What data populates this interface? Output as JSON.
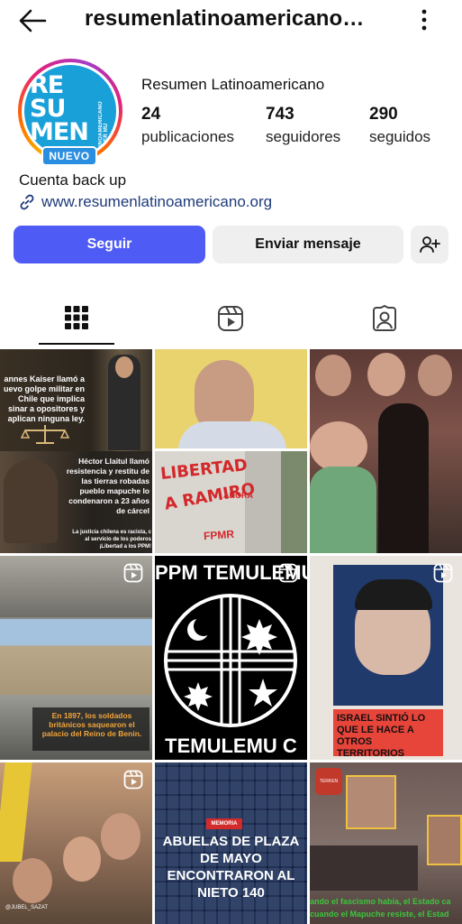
{
  "header": {
    "title": "resumenlatinoamericano…",
    "back_icon": "arrow-left-icon",
    "more_icon": "more-vertical-icon"
  },
  "profile": {
    "avatar_logo": {
      "line1": "RE",
      "line2": "SU",
      "line3": "MEN",
      "vertical": "LATINOAMERICANO TERCER MU"
    },
    "badge": "NUEVO",
    "name": "Resumen Latinoamericano",
    "stats": [
      {
        "value": "24",
        "label": "publicaciones"
      },
      {
        "value": "743",
        "label": "seguidores"
      },
      {
        "value": "290",
        "label": "seguidos"
      }
    ],
    "bio": "Cuenta back up",
    "link": "www.resumenlatinoamericano.org"
  },
  "actions": {
    "follow": "Seguir",
    "message": "Enviar mensaje",
    "add_user_icon": "add-user-icon"
  },
  "tabs": [
    {
      "name": "grid",
      "icon": "grid-icon",
      "active": true
    },
    {
      "name": "reels",
      "icon": "reels-icon",
      "active": false
    },
    {
      "name": "tagged",
      "icon": "tagged-icon",
      "active": false
    }
  ],
  "posts": {
    "p1_text_a": "annes Kaiser llamó a uevo golpe militar en Chile que implica sinar a opositores y aplican ninguna ley.",
    "p1_text_b": "Héctor Llaitul llamó resistencia y restitu de las tierras robadas pueblo mapuche lo condenaron a 23 años de cárcel",
    "p1_text_c": "La justicia chilena es racista, c al servicio de los poderos ¡Libertad a los PPM!",
    "p2_graffiti_1": "LIBERTAD",
    "p2_graffiti_2": "A RAMIRO",
    "p2_graffiti_3": "AHORA",
    "p2_graffiti_4": "FPMR",
    "p4_caption": "En 1897, los soldados británicos saquearon el palacio del Reino de Benin.",
    "p5_top": "PPM TEMULEMU",
    "p5_bottom": "TEMULEMU C",
    "p6_caption": "ISRAEL SINTIÓ LO QUE LE HACE A OTROS TERRITORIOS",
    "p8_tag": "MEMORIA",
    "p8_caption": "ABUELAS DE PLAZA DE MAYO ENCONTRARON AL NIETO 140",
    "p9_caption_1": "ando el fascismo había, el Estado ca",
    "p9_caption_2": "cuando el Mapuche resiste, el Estad",
    "p7_watermark": "@JUBEL_SAZAT",
    "p9_logo": "TERKEN"
  },
  "colors": {
    "follow_button": "#4f5bf5",
    "secondary_button": "#efefef",
    "link": "#1e3a7a"
  }
}
